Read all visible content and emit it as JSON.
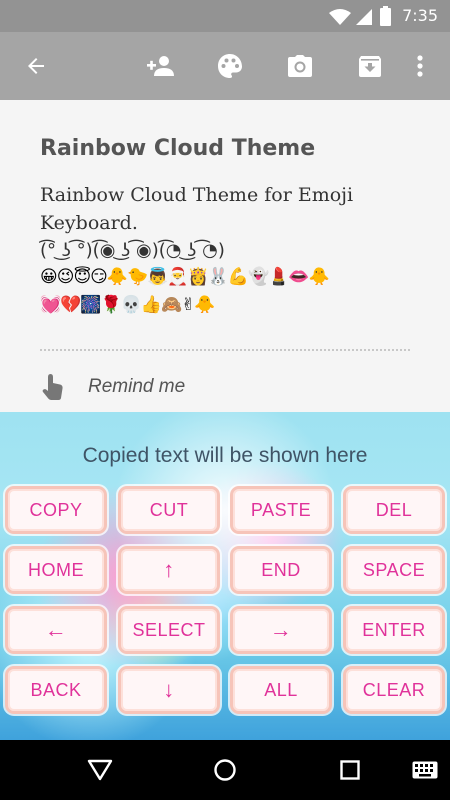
{
  "status_bar": {
    "time": "7:35"
  },
  "toolbar": {
    "icons": [
      "back-arrow-icon",
      "add-person-icon",
      "palette-icon",
      "camera-icon",
      "archive-icon",
      "more-vert-icon"
    ]
  },
  "note": {
    "title": "Rainbow Cloud Theme",
    "body_line": "Rainbow Cloud Theme for Emoji Keyboard.",
    "kaomoji": "(͡° ͜ʖ ͡°)(͡◉ ͜ʖ ͡◉)(͡◔ ͜ʖ ͡◔)",
    "emoji_row_1": "😀😉😇😏🐥🐤👼🎅👸🐰💪👻💄👄🐥",
    "emoji_row_2": "💓💔🎆🌹💀👍🙈✌🐥",
    "reminder_label": "Remind me"
  },
  "keyboard": {
    "caption": "Copied text will be shown here",
    "keys": [
      {
        "label": "COPY"
      },
      {
        "label": "CUT"
      },
      {
        "label": "PASTE"
      },
      {
        "label": "DEL"
      },
      {
        "label": "HOME"
      },
      {
        "label": "↑"
      },
      {
        "label": "END"
      },
      {
        "label": "SPACE"
      },
      {
        "label": "←"
      },
      {
        "label": "SELECT"
      },
      {
        "label": "→"
      },
      {
        "label": "ENTER"
      },
      {
        "label": "BACK"
      },
      {
        "label": "↓"
      },
      {
        "label": "ALL"
      },
      {
        "label": "CLEAR"
      }
    ]
  },
  "navbar": {
    "icons": [
      "back-triangle-icon",
      "home-circle-icon",
      "recents-square-icon",
      "keyboard-icon"
    ]
  },
  "colors": {
    "status_bar": "#939393",
    "app_bar": "#a5a5a5",
    "key_text": "#e0329a",
    "key_border": "#f6c4b9"
  }
}
